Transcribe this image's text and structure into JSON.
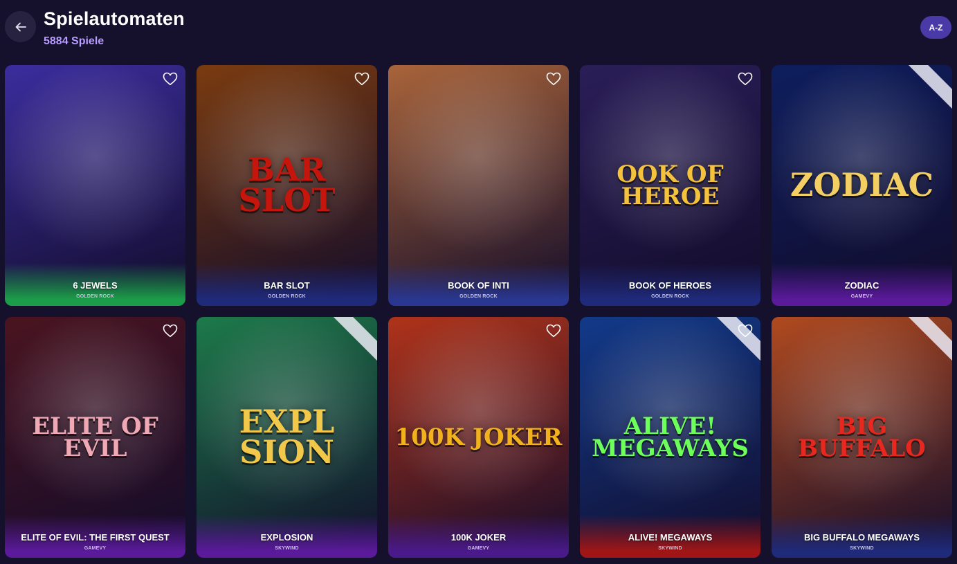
{
  "header": {
    "title": "Spielautomaten",
    "count": "5884 Spiele",
    "sort_label": "A-Z"
  },
  "icons": {
    "back": "arrow-left-icon",
    "favorite": "heart-outline-icon"
  },
  "games": [
    {
      "name": "6 JEWELS",
      "provider": "GOLDEN ROCK",
      "bg": "#3b2d9e",
      "accent": "#1c9c48",
      "corner": false
    },
    {
      "name": "BAR SLOT",
      "provider": "GOLDEN ROCK",
      "bg": "#7a3b10",
      "accent": "#1f2a7a",
      "corner": false
    },
    {
      "name": "BOOK OF INTI",
      "provider": "GOLDEN ROCK",
      "bg": "#a9643a",
      "accent": "#2a3790",
      "corner": false
    },
    {
      "name": "BOOK OF HEROES",
      "provider": "GOLDEN ROCK",
      "bg": "#2a1e58",
      "accent": "#1f2a7a",
      "corner": false
    },
    {
      "name": "ZODIAC",
      "provider": "GAMEVY",
      "bg": "#0e1e5e",
      "accent": "#5a1a9a",
      "corner": true
    },
    {
      "name": "ELITE OF EVIL: THE FIRST QUEST",
      "provider": "GAMEVY",
      "bg": "#4a1420",
      "accent": "#5a1a9a",
      "corner": false
    },
    {
      "name": "EXPLOSION",
      "provider": "SKYWIND",
      "bg": "#1d7a4a",
      "accent": "#5a1a9a",
      "corner": true
    },
    {
      "name": "100K JOKER",
      "provider": "GAMEVY",
      "bg": "#b0331a",
      "accent": "#4a1a8a",
      "corner": false
    },
    {
      "name": "ALIVE! MEGAWAYS",
      "provider": "SKYWIND",
      "bg": "#123a8a",
      "accent": "#a01616",
      "corner": true
    },
    {
      "name": "BIG BUFFALO MEGAWAYS",
      "provider": "SKYWIND",
      "bg": "#b04a20",
      "accent": "#1f2a7a",
      "corner": true
    }
  ],
  "art": [
    {
      "logo": "",
      "logo_color": "#ffffff"
    },
    {
      "logo": "BAR SLOT",
      "logo_color": "#c4160c"
    },
    {
      "logo": "",
      "logo_color": "#ffffff"
    },
    {
      "logo": "OOK OF HEROE",
      "logo_color": "#f5c23c"
    },
    {
      "logo": "ZODIAC",
      "logo_color": "#f3cf63"
    },
    {
      "logo": "ELITE OF EVIL",
      "logo_color": "#f0a8b4"
    },
    {
      "logo": "EXPL SION",
      "logo_color": "#f2c84a"
    },
    {
      "logo": "100K JOKER",
      "logo_color": "#f2b21c"
    },
    {
      "logo": "ALIVE! MEGAWAYS",
      "logo_color": "#6dff5a"
    },
    {
      "logo": "BIG BUFFALO",
      "logo_color": "#e8281e"
    }
  ]
}
